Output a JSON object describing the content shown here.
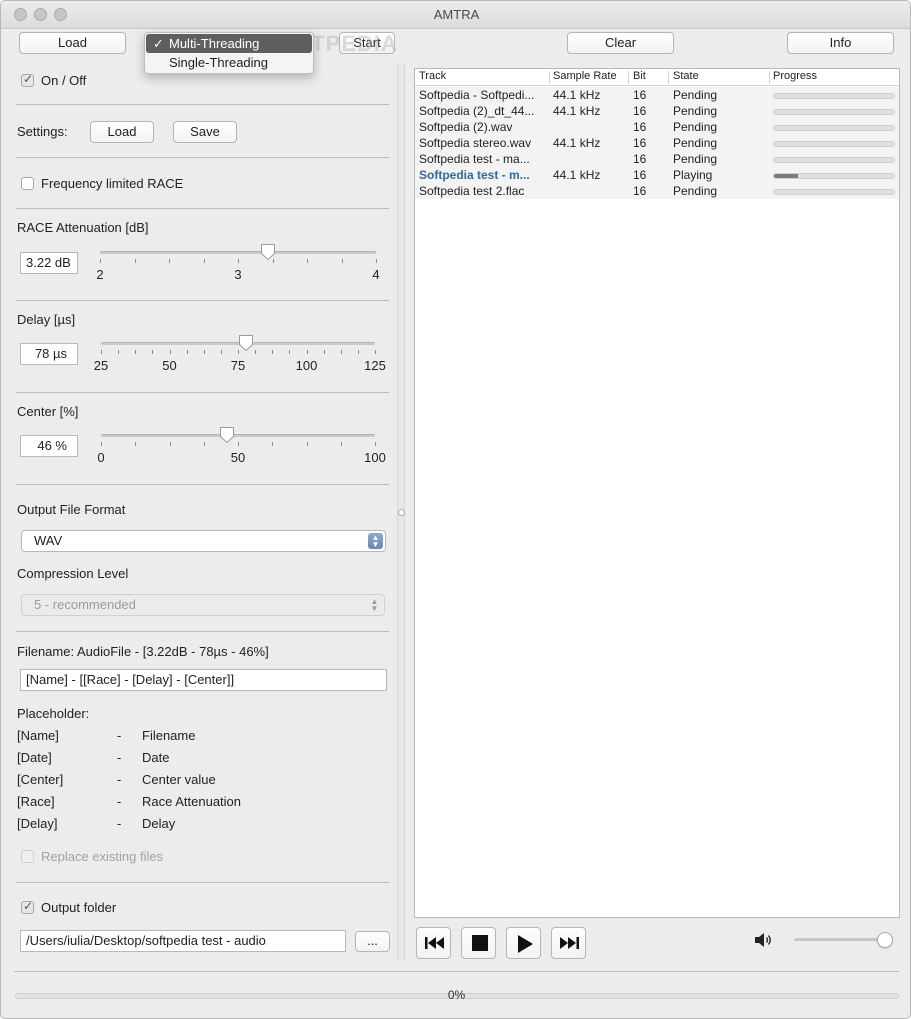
{
  "window": {
    "title": "AMTRA"
  },
  "toolbar": {
    "load": "Load",
    "start": "Start",
    "clear": "Clear",
    "info": "Info"
  },
  "thread_menu": {
    "items": [
      {
        "label": "Multi-Threading",
        "checked": true
      },
      {
        "label": "Single-Threading",
        "checked": false
      }
    ],
    "check_glyph": "✓"
  },
  "watermark": "SOFTPEDIA",
  "settings": {
    "on_off": {
      "label": "On / Off",
      "checked": true
    },
    "settings_label": "Settings:",
    "load": "Load",
    "save": "Save",
    "freq_race": {
      "label": "Frequency limited RACE",
      "checked": false
    },
    "race": {
      "label": "RACE Attenuation [dB]",
      "value": "3.22 dB",
      "level": 3.22,
      "min": 2,
      "max": 4,
      "ticks": [
        "2",
        "3",
        "4"
      ]
    },
    "delay": {
      "label": "Delay [µs]",
      "value": "78 µs",
      "level": 78,
      "min": 25,
      "max": 125,
      "ticks": [
        "25",
        "50",
        "75",
        "100",
        "125"
      ]
    },
    "center": {
      "label": "Center [%]",
      "value": "46 %",
      "level": 46,
      "min": 0,
      "max": 100,
      "ticks": [
        "0",
        "50",
        "100"
      ]
    },
    "output_format": {
      "label": "Output File Format",
      "value": "WAV"
    },
    "compression": {
      "label": "Compression Level",
      "value": "5 - recommended"
    },
    "filename": {
      "label": "Filename: AudioFile - [3.22dB - 78µs - 46%]",
      "pattern": "[Name] - [[Race] - [Delay] - [Center]]"
    },
    "placeholder": {
      "title": "Placeholder:",
      "items": [
        {
          "key": "[Name]",
          "dash": "-",
          "desc": "Filename"
        },
        {
          "key": "[Date]",
          "dash": "-",
          "desc": "Date"
        },
        {
          "key": "[Center]",
          "dash": "-",
          "desc": "Center value"
        },
        {
          "key": "[Race]",
          "dash": "-",
          "desc": "Race Attenuation"
        },
        {
          "key": "[Delay]",
          "dash": "-",
          "desc": "Delay"
        }
      ]
    },
    "replace": {
      "label": "Replace existing files",
      "checked": false
    },
    "output_folder": {
      "label": "Output folder",
      "checked": true,
      "path": "/Users/iulia/Desktop/softpedia test - audio",
      "browse": "..."
    }
  },
  "table": {
    "headers": [
      "Track",
      "Sample Rate",
      "Bit",
      "State",
      "Progress"
    ],
    "rows": [
      {
        "track": "Softpedia - Softpedi...",
        "rate": "44.1 kHz",
        "bit": "16",
        "state": "Pending",
        "progress": 0
      },
      {
        "track": "Softpedia (2)_dt_44...",
        "rate": "44.1 kHz",
        "bit": "16",
        "state": "Pending",
        "progress": 0
      },
      {
        "track": "Softpedia (2).wav",
        "rate": "",
        "bit": "16",
        "state": "Pending",
        "progress": 0
      },
      {
        "track": "Softpedia stereo.wav",
        "rate": "44.1 kHz",
        "bit": "16",
        "state": "Pending",
        "progress": 0
      },
      {
        "track": "Softpedia test - ma...",
        "rate": "",
        "bit": "16",
        "state": "Pending",
        "progress": 0
      },
      {
        "track": "Softpedia test - m...",
        "rate": "44.1 kHz",
        "bit": "16",
        "state": "Playing",
        "progress": 0.2,
        "playing": true
      },
      {
        "track": "Softpedia test 2.flac",
        "rate": "",
        "bit": "16",
        "state": "Pending",
        "progress": 0
      }
    ]
  },
  "transport": {
    "volume": 1.0
  },
  "status": {
    "progress_text": "0%",
    "progress": 0
  }
}
